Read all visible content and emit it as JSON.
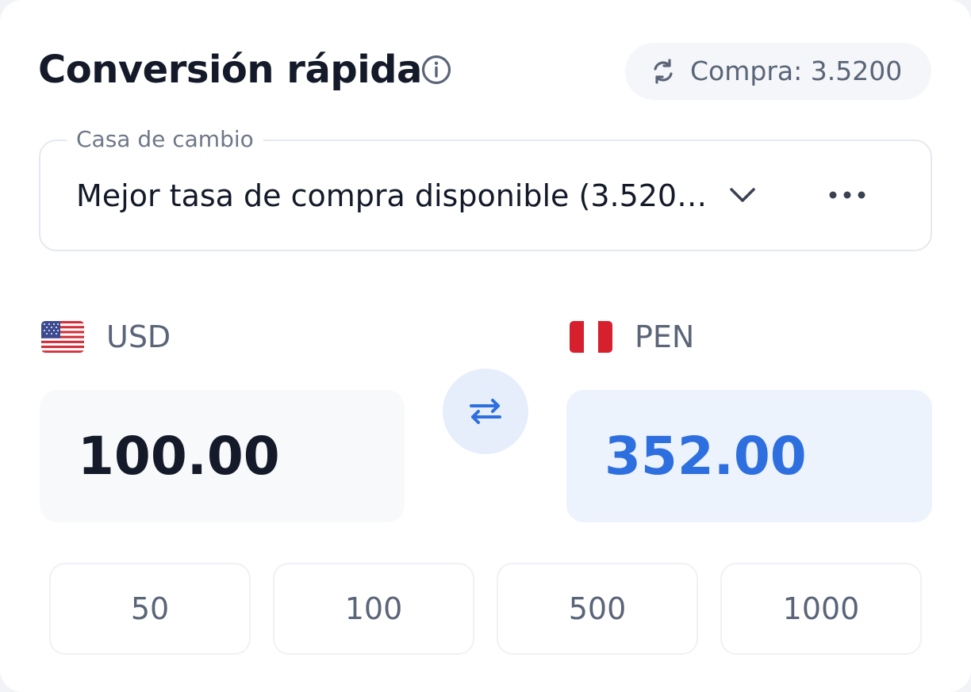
{
  "header": {
    "title": "Conversión rápida",
    "rate_label": "Compra: 3.5200"
  },
  "exchange_select": {
    "label": "Casa de cambio",
    "value": "Mejor tasa de compra disponible (3.520…"
  },
  "from": {
    "currency": "USD",
    "amount": "100.00",
    "flag": "us-flag"
  },
  "to": {
    "currency": "PEN",
    "amount": "352.00",
    "flag": "peru-flag"
  },
  "quick_amounts": [
    "50",
    "100",
    "500",
    "1000"
  ],
  "colors": {
    "accent": "#2e6fe0",
    "accent_bg": "#edf3fd",
    "text_primary": "#141a29",
    "text_secondary": "#5b6578"
  },
  "icons": {
    "info": "info-icon",
    "sync": "sync-icon",
    "chevron": "chevron-down-icon",
    "more": "more-icon",
    "swap": "swap-icon"
  }
}
